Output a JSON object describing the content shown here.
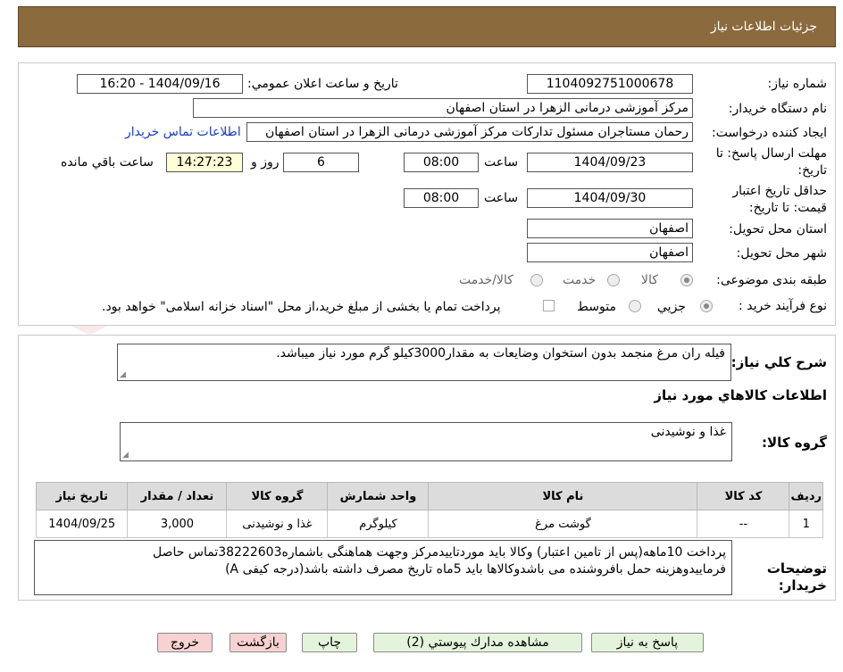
{
  "header": {
    "title": "جزئیات اطلاعات نیاز"
  },
  "form": {
    "need_number_label": "شماره نیاز:",
    "need_number": "1104092751000678",
    "announce_label": "تاریخ و ساعت اعلان عمومي:",
    "announce_value": "1404/09/16 - 16:20",
    "buyer_label": "نام دستگاه خریدار:",
    "buyer_value": "مرکز آموزشی درمانی الزهرا در استان اصفهان",
    "requester_label": "ایجاد کننده درخواست:",
    "requester_value": "رحمان مستاجران مسئول تداركات مرکز آموزشی درمانی الزهرا در استان اصفهان",
    "contact_link": "اطلاعات تماس خریدار",
    "deadline_label_1": "مهلت ارسال پاسخ: تا",
    "deadline_label_2": "تاریخ:",
    "deadline_date": "1404/09/23",
    "time_label": "ساعت",
    "deadline_time": "08:00",
    "days_value": "6",
    "days_label": "روز و",
    "remaining_time": "14:27:23",
    "remaining_label": "ساعت باقي مانده",
    "validity_label_1": "حداقل تاریخ اعتبار",
    "validity_label_2": "قیمت: تا تاریخ:",
    "validity_date": "1404/09/30",
    "validity_time": "08:00",
    "province_label": "استان محل تحویل:",
    "province_value": "اصفهان",
    "city_label": "شهر محل تحویل:",
    "city_value": "اصفهان",
    "category_label": "طبقه بندی موضوعی:",
    "category_options": [
      "کالا",
      "خدمت",
      "کالا/خدمت"
    ],
    "category_selected": "کالا",
    "process_label": "نوع فرآیند خرید :",
    "process_options": [
      "جزیي",
      "متوسط"
    ],
    "process_selected": "جزیي",
    "payment_note": "پرداخت تمام یا بخشی از مبلغ خرید،از محل \"اسناد خزانه اسلامی\" خواهد بود."
  },
  "summary": {
    "label": "شرح کلي نیاز:",
    "value": "فیله ران مرغ منجمد بدون استخوان وضایعات به مقدار3000کیلو گرم مورد نیاز میباشد.",
    "goods_info_title": "اطلاعات کالاهاي مورد نیاز",
    "group_label": "گروه کالا:",
    "group_value": "غذا و نوشیدنی"
  },
  "table": {
    "headers": [
      "ردیف",
      "کد کالا",
      "نام کالا",
      "واحد شمارش",
      "گروه کالا",
      "تعداد / مقدار",
      "تاریخ نیاز"
    ],
    "rows": [
      {
        "row": "1",
        "code": "--",
        "name": "گوشت مرغ",
        "unit": "کیلوگرم",
        "group": "غذا و نوشیدنی",
        "qty": "3,000",
        "date": "1404/09/25"
      }
    ]
  },
  "notes": {
    "label_1": "توضیحات",
    "label_2": "خریدار:",
    "line1": "پرداخت 10ماهه(پس از تامین اعتبار)  وکالا باید موردتاییدمرکز وجهت هماهنگی  باشماره38222603تماس حاصل",
    "line2": "فرماییدوهزینه حمل بافروشنده می باشدوکالاها باید 5ماه تاریخ مصرف داشته باشد(درجه کیفی A)"
  },
  "buttons": {
    "reply": "پاسخ به نیاز",
    "docs": "مشاهده مدارك پیوستي (2)",
    "print": "چاپ",
    "back": "بازگشت",
    "exit": "خروج"
  },
  "colors": {
    "header_bg": "#8b6a3e",
    "link": "#1a3cc9",
    "remaining_bg": "#fffdd6",
    "button_green": "#e4f4dc",
    "button_pink": "#f7d2d2"
  },
  "watermark_text": "AriaTender.neT"
}
